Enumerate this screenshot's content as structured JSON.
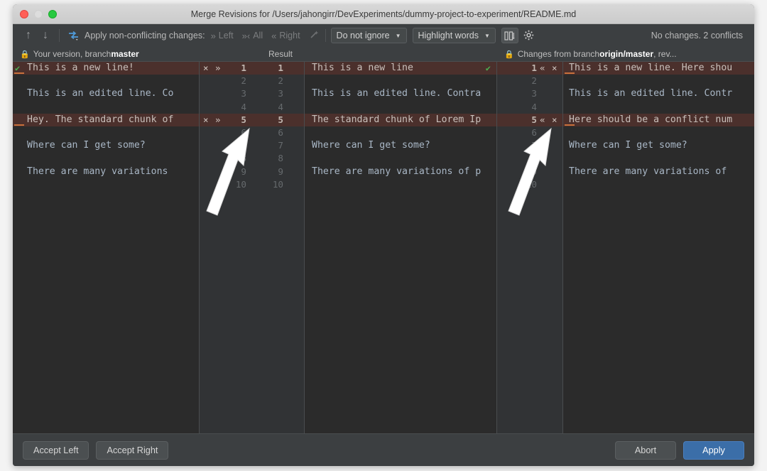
{
  "window": {
    "title": "Merge Revisions for /Users/jahongirr/DevExperiments/dummy-project-to-experiment/README.md",
    "traffic_lights": [
      "close-button",
      "minimize-button",
      "maximize-button"
    ]
  },
  "toolbar": {
    "prev_icon": "arrow-up-icon",
    "next_icon": "arrow-down-icon",
    "magic_resolve_icon": "magic-resolve-icon",
    "apply_label": "Apply non-conflicting changes:",
    "apply_left": "Left",
    "apply_all": "All",
    "apply_right": "Right",
    "wand_icon": "magic-wand-icon",
    "ignore_policy": "Do not ignore",
    "highlight_policy": "Highlight words",
    "collapse_icon": "collapse-unchanged-icon",
    "settings_icon": "gear-icon",
    "status": "No changes. 2 conflicts"
  },
  "panes": {
    "left": {
      "lock_icon": "lock-icon",
      "title_prefix": "Your version, branch ",
      "title_branch": "master",
      "lines": [
        "This is a new line!",
        "",
        "This is an edited line. Co",
        "",
        "Hey. The standard chunk of",
        "",
        "Where can I get some?",
        "",
        "There are many variations",
        ""
      ]
    },
    "result": {
      "title": "Result",
      "lines": [
        "This is a new line",
        "",
        "This is an edited line. Contra",
        "",
        "The standard chunk of Lorem Ip",
        "",
        "Where can I get some?",
        "",
        "There are many variations of p",
        ""
      ]
    },
    "right": {
      "lock_icon": "lock-icon",
      "title_prefix": "Changes from branch ",
      "title_branch": "origin/master",
      "title_suffix": ", rev...",
      "lines": [
        "This is a new line. Here shou",
        "",
        "This is an edited line. Contr",
        "",
        "Here should be a conflict num",
        "",
        "Where can I get some?",
        "",
        "There are many variations of",
        ""
      ]
    }
  },
  "gutter": {
    "left_numbers": [
      "1",
      "2",
      "3",
      "4",
      "5",
      "6",
      "7",
      "8",
      "9",
      "10"
    ],
    "result_numbers": [
      "1",
      "2",
      "3",
      "4",
      "5",
      "6",
      "7",
      "8",
      "9",
      "10"
    ],
    "right_numbers": [
      "1",
      "2",
      "3",
      "4",
      "5",
      "6",
      "7",
      "8",
      "9",
      "10"
    ],
    "conflict_rows": [
      0,
      4
    ],
    "left_actions": {
      "reject": "×",
      "accept": "»"
    },
    "right_actions": {
      "accept": "«",
      "reject": "×"
    }
  },
  "footer": {
    "accept_left": "Accept Left",
    "accept_right": "Accept Right",
    "abort": "Abort",
    "apply": "Apply"
  },
  "colors": {
    "window_chrome": "#3c3f41",
    "editor_bg": "#2b2b2b",
    "gutter_bg": "#313335",
    "conflict_bg": "#4b302c",
    "code_fg": "#a9b7c6",
    "accent_primary": "#3b6ea8",
    "ok_green": "#4caf50",
    "change_marker": "#c8703c"
  }
}
